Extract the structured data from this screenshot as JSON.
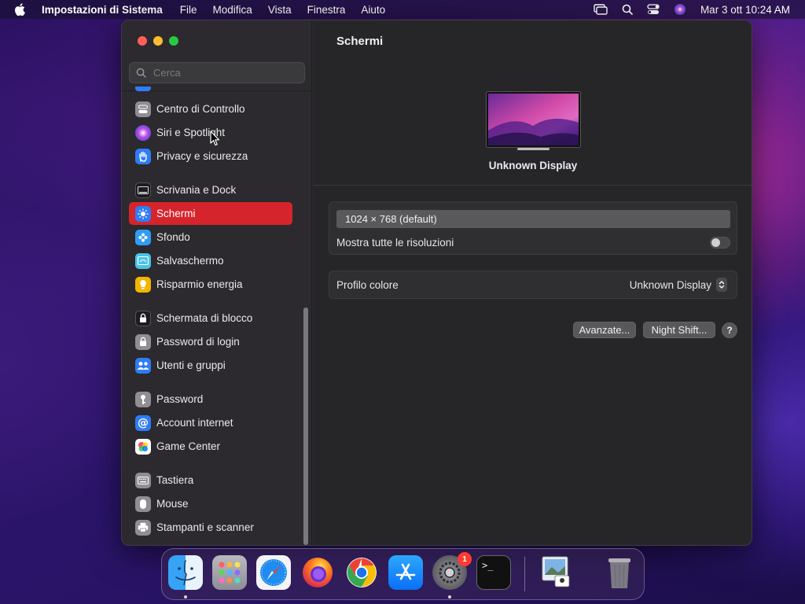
{
  "menubar": {
    "app_name": "Impostazioni di Sistema",
    "menus": [
      "File",
      "Modifica",
      "Vista",
      "Finestra",
      "Aiuto"
    ],
    "datetime": "Mar 3 ott  10:24 AM"
  },
  "sidebar": {
    "search_placeholder": "Cerca",
    "items": [
      {
        "label": "Centro di Controllo",
        "icon": "control-center-icon",
        "color": "#8e8e93"
      },
      {
        "label": "Siri e Spotlight",
        "icon": "siri-icon",
        "color": "#b03ad0"
      },
      {
        "label": "Privacy e sicurezza",
        "icon": "hand-icon",
        "color": "#2f7cf6"
      },
      {
        "label": "Scrivania e Dock",
        "icon": "desktop-dock-icon",
        "color": "#1c1c1e"
      },
      {
        "label": "Schermi",
        "icon": "sun-icon",
        "color": "#2f7cf6",
        "selected": true
      },
      {
        "label": "Sfondo",
        "icon": "flower-icon",
        "color": "#2f9df6"
      },
      {
        "label": "Salvaschermo",
        "icon": "screensaver-icon",
        "color": "#4cc3e8"
      },
      {
        "label": "Risparmio energia",
        "icon": "bulb-icon",
        "color": "#f4b400"
      },
      {
        "label": "Schermata di blocco",
        "icon": "lock-screen-icon",
        "color": "#1c1c1e"
      },
      {
        "label": "Password di login",
        "icon": "lock-icon",
        "color": "#8e8e93"
      },
      {
        "label": "Utenti e gruppi",
        "icon": "users-icon",
        "color": "#2f7cf6"
      },
      {
        "label": "Password",
        "icon": "key-icon",
        "color": "#8e8e93"
      },
      {
        "label": "Account internet",
        "icon": "at-icon",
        "color": "#2f7cf6"
      },
      {
        "label": "Game Center",
        "icon": "game-center-icon",
        "color": "#ffffff"
      },
      {
        "label": "Tastiera",
        "icon": "keyboard-icon",
        "color": "#8e8e93"
      },
      {
        "label": "Mouse",
        "icon": "mouse-icon",
        "color": "#8e8e93"
      },
      {
        "label": "Stampanti e scanner",
        "icon": "printer-icon",
        "color": "#8e8e93"
      }
    ]
  },
  "content": {
    "title": "Schermi",
    "display_name": "Unknown Display",
    "resolution_selected": "1024 × 768 (default)",
    "show_all_resolutions_label": "Mostra tutte le risoluzioni",
    "show_all_resolutions_on": false,
    "color_profile_label": "Profilo colore",
    "color_profile_value": "Unknown Display",
    "advanced_button": "Avanzate...",
    "night_shift_button": "Night Shift...",
    "help_button": "?"
  },
  "dock": {
    "apps": [
      "Finder",
      "Launchpad",
      "Safari",
      "Firefox",
      "Chrome",
      "App Store",
      "Impostazioni di Sistema",
      "Terminale",
      "Anteprima",
      "Cestino"
    ],
    "settings_badge": "1"
  },
  "colors": {
    "accent": "#d6242c",
    "window_bg": "#262628",
    "sidebar_bg": "#2c2a2e"
  }
}
